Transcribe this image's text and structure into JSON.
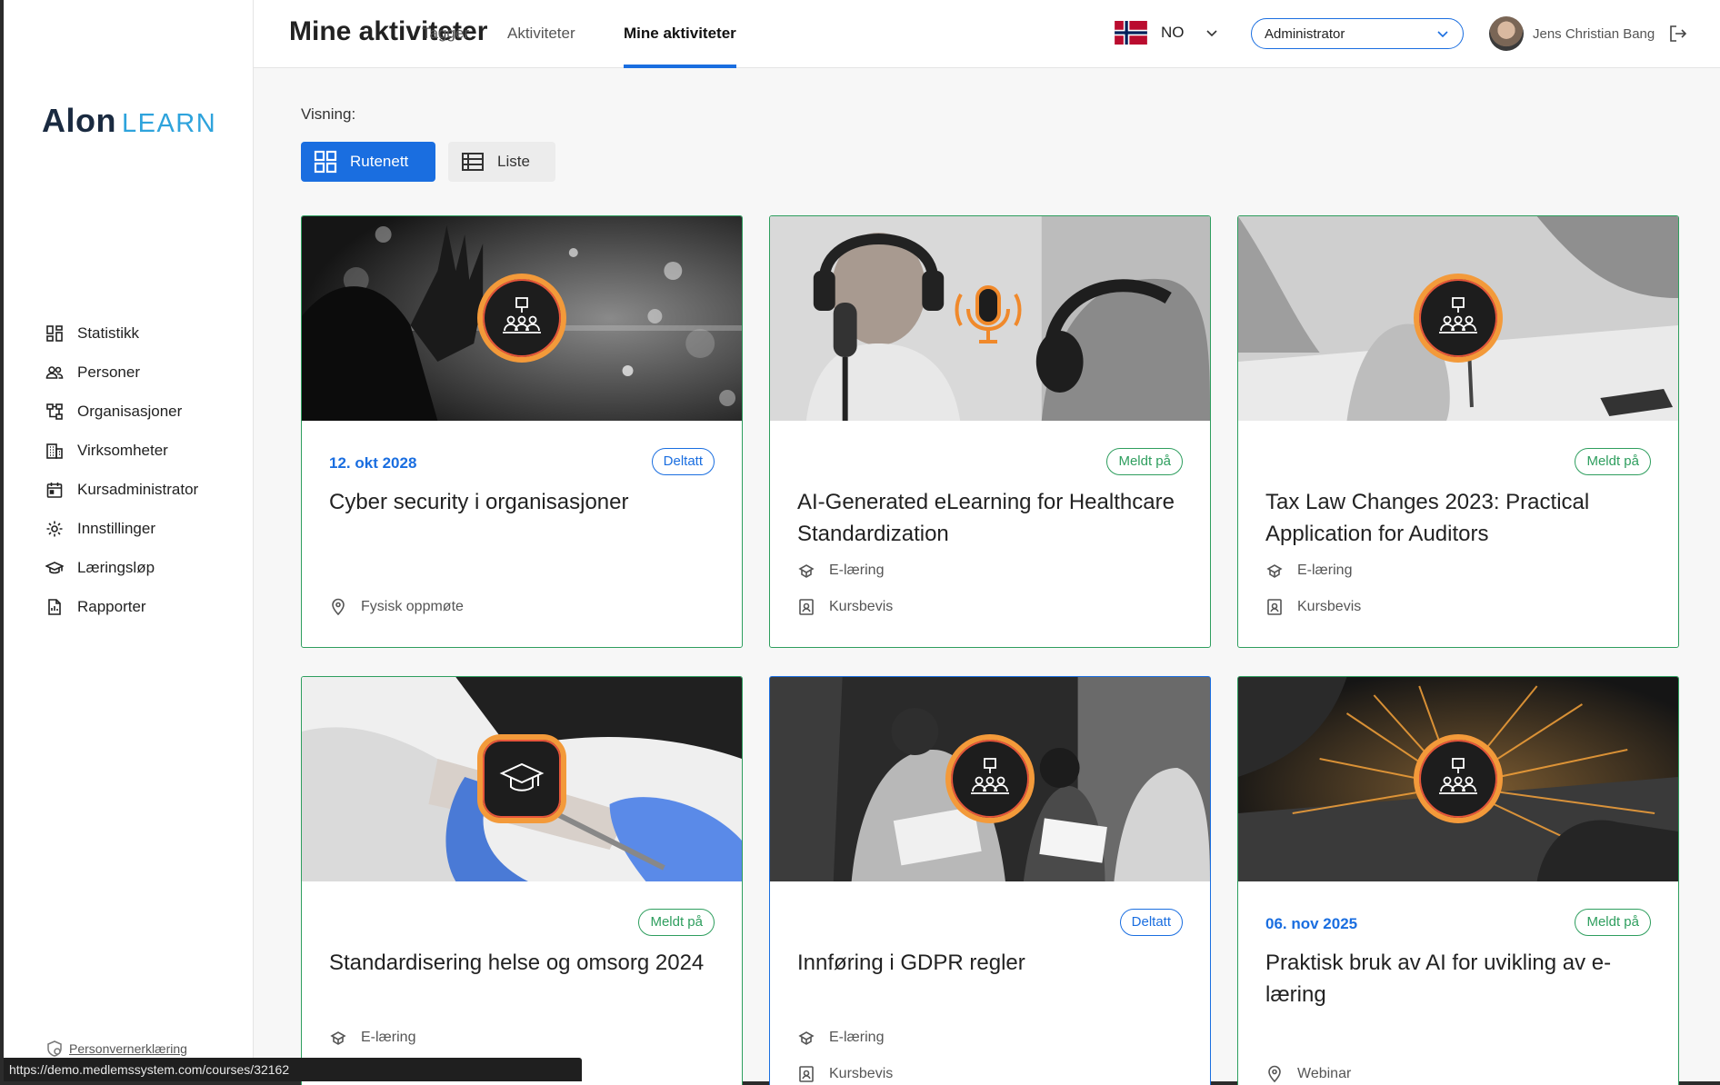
{
  "brand": {
    "logo_text": "Alon",
    "logo_sub": "LEARN"
  },
  "sidebar": {
    "items": [
      {
        "label": "Statistikk",
        "icon": "dashboard-icon"
      },
      {
        "label": "Personer",
        "icon": "people-icon"
      },
      {
        "label": "Organisasjoner",
        "icon": "org-chart-icon"
      },
      {
        "label": "Virksomheter",
        "icon": "building-icon"
      },
      {
        "label": "Kursadministrator",
        "icon": "calendar-icon"
      },
      {
        "label": "Innstillinger",
        "icon": "gear-icon"
      },
      {
        "label": "Læringsløp",
        "icon": "graduation-cap-icon"
      },
      {
        "label": "Rapporter",
        "icon": "report-icon"
      }
    ],
    "privacy_link": "Personvernerklæring"
  },
  "header": {
    "title": "Mine aktiviteter",
    "tabs": [
      {
        "label": "Tagger",
        "active": false
      },
      {
        "label": "Aktiviteter",
        "active": false
      },
      {
        "label": "Mine aktiviteter",
        "active": true
      }
    ],
    "language": "NO",
    "role": "Administrator",
    "user_name": "Jens Christian Bang"
  },
  "view": {
    "label": "Visning:",
    "grid_label": "Rutenett",
    "list_label": "Liste"
  },
  "cards": [
    {
      "date": "12. okt 2028",
      "status": "Deltatt",
      "title": "Cyber security i organisasjoner",
      "meta": [
        {
          "icon": "location-pin-icon",
          "text": "Fysisk oppmøte"
        }
      ]
    },
    {
      "date": "",
      "status": "Meldt på",
      "title": "AI-Generated eLearning for Healthcare Standardization",
      "meta": [
        {
          "icon": "elearning-icon",
          "text": "E-læring"
        },
        {
          "icon": "certificate-icon",
          "text": "Kursbevis"
        }
      ]
    },
    {
      "date": "",
      "status": "Meldt på",
      "title": "Tax Law Changes 2023: Practical Application for Auditors",
      "meta": [
        {
          "icon": "elearning-icon",
          "text": "E-læring"
        },
        {
          "icon": "certificate-icon",
          "text": "Kursbevis"
        }
      ]
    },
    {
      "date": "",
      "status": "Meldt på",
      "title": "Standardisering helse og omsorg 2024",
      "meta": [
        {
          "icon": "elearning-icon",
          "text": "E-læring"
        }
      ]
    },
    {
      "date": "",
      "status": "Deltatt",
      "title": "Innføring i GDPR regler",
      "meta": [
        {
          "icon": "elearning-icon",
          "text": "E-læring"
        },
        {
          "icon": "certificate-icon",
          "text": "Kursbevis"
        }
      ]
    },
    {
      "date": "06. nov 2025",
      "status": "Meldt på",
      "title": "Praktisk bruk av AI for uvikling av e-læring",
      "meta": [
        {
          "icon": "location-pin-icon",
          "text": "Webinar"
        }
      ]
    }
  ],
  "status_url": "https://demo.medlemssystem.com/courses/32162",
  "colors": {
    "accent": "#1a6ee0",
    "success": "#2e9e5e",
    "badge_ring": "#f39a3a"
  }
}
